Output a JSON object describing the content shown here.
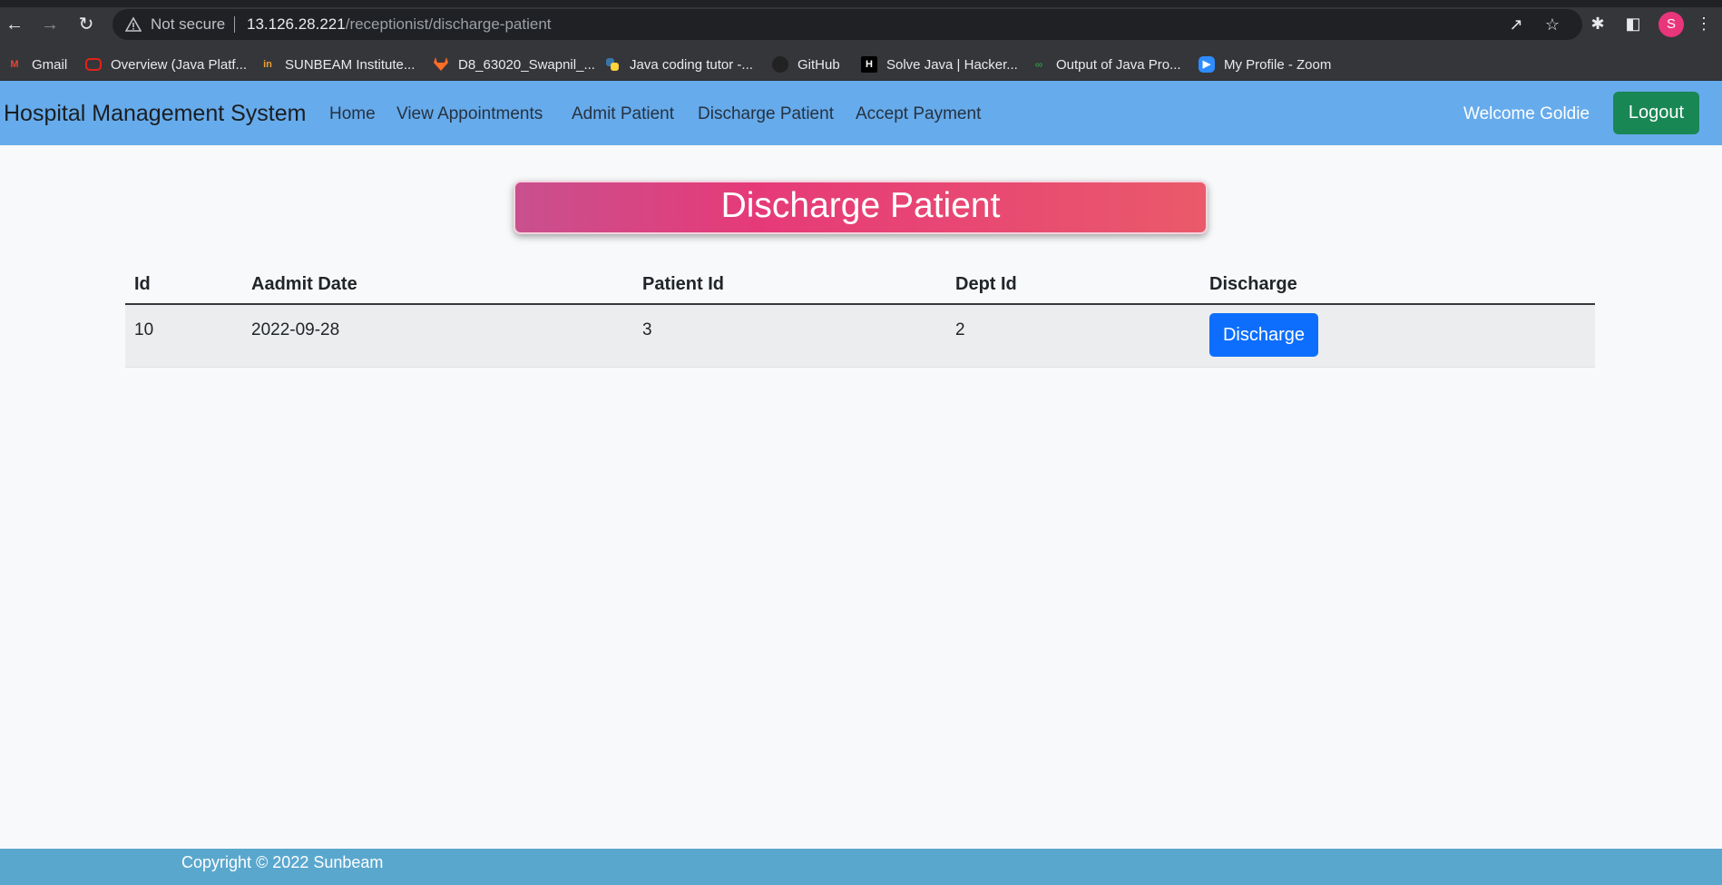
{
  "browser": {
    "security_label": "Not secure",
    "url_host": "13.126.28.221",
    "url_path": "/receptionist/discharge-patient",
    "profile_initial": "S",
    "bookmarks": [
      {
        "label": "Gmail",
        "icon": "gmail-icon",
        "color": "#ea4335"
      },
      {
        "label": "Overview (Java Platf...",
        "icon": "oracle-icon",
        "color": "#e2231a"
      },
      {
        "label": "SUNBEAM Institute...",
        "icon": "sunbeam-icon",
        "color": "#f0a030"
      },
      {
        "label": "D8_63020_Swapnil_...",
        "icon": "gitlab-icon",
        "color": "#fc6d26"
      },
      {
        "label": "Java coding tutor -...",
        "icon": "python-icon",
        "color": "#3776ab"
      },
      {
        "label": "GitHub",
        "icon": "github-icon",
        "color": "#222222"
      },
      {
        "label": "Solve Java | Hacker...",
        "icon": "hackerrank-icon",
        "color": "#000000"
      },
      {
        "label": "Output of Java Pro...",
        "icon": "geeksforgeeks-icon",
        "color": "#2f8d46"
      },
      {
        "label": "My Profile - Zoom",
        "icon": "zoom-icon",
        "color": "#2d8cff"
      }
    ]
  },
  "navbar": {
    "brand": "Hospital Management System",
    "links": [
      "Home",
      "View Appointments",
      "Admit Patient",
      "Discharge Patient",
      "Accept Payment"
    ],
    "welcome": "Welcome Goldie",
    "logout_label": "Logout"
  },
  "main": {
    "heading": "Discharge Patient",
    "table": {
      "columns": [
        "Id",
        "Aadmit Date",
        "Patient Id",
        "Dept Id",
        "Discharge"
      ],
      "rows": [
        {
          "id": "10",
          "admit_date": "2022-09-28",
          "patient_id": "3",
          "dept_id": "2",
          "action_label": "Discharge"
        }
      ]
    }
  },
  "footer": {
    "text": "Copyright © 2022 Sunbeam"
  },
  "colors": {
    "navbar_bg": "#66abec",
    "logout_bg": "#198754",
    "discharge_btn_bg": "#0d6efd",
    "footer_bg": "#5aa7ce"
  }
}
